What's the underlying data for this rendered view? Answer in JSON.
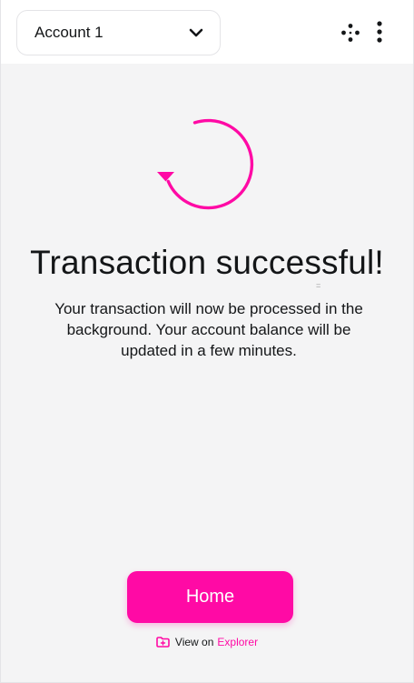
{
  "header": {
    "account_label": "Account 1",
    "chevron_icon": "chevron-down-icon",
    "network_icon": "network-nodes-icon",
    "menu_icon": "kebab-menu-icon"
  },
  "status": {
    "icon": "refresh-arrow-icon",
    "title": "Transaction successful!",
    "description": "Your transaction will now be processed in the background. Your account balance will be updated in a few minutes."
  },
  "actions": {
    "home_label": "Home",
    "explorer_prefix": "View on",
    "explorer_link": "Explorer",
    "explorer_icon": "folder-icon"
  },
  "colors": {
    "accent": "#ff0aa5",
    "background": "#f4f4f5",
    "text": "#141618"
  }
}
